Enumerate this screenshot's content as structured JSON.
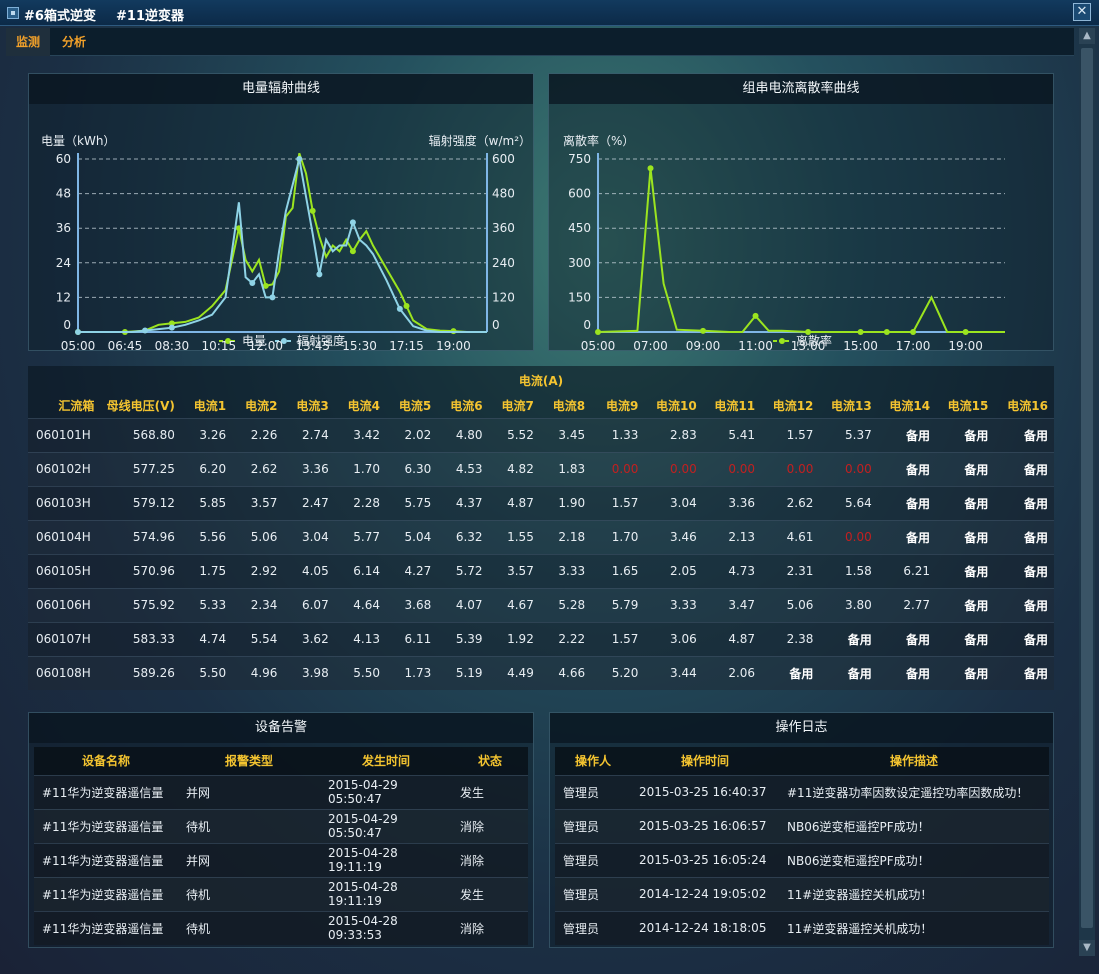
{
  "window": {
    "title_left": "#6箱式逆变",
    "title_right": "#11逆变器",
    "close_glyph": "✕",
    "tabs": [
      {
        "label": "监测"
      },
      {
        "label": "分析"
      }
    ]
  },
  "charts": {
    "energy": {
      "panel_title": "电量辐射曲线",
      "left_unit": "电量（kWh）",
      "right_unit": "辐射强度（w/m²）",
      "legend_energy": "电量",
      "legend_radiation": "辐射强度"
    },
    "dispersion": {
      "panel_title": "组串电流离散率曲线",
      "unit": "离散率（%）",
      "legend": "离散率"
    }
  },
  "chart_data": [
    {
      "type": "line",
      "title": "电量辐射曲线",
      "ylabel": "电量（kWh）",
      "y2label": "辐射强度（w/m²）",
      "ylim": [
        0,
        60
      ],
      "y2lim": [
        0,
        600
      ],
      "yticks": [
        "0",
        "12",
        "24",
        "36",
        "48",
        "60"
      ],
      "y2ticks": [
        "0",
        "120",
        "240",
        "360",
        "480",
        "600"
      ],
      "xlim": [
        5,
        20.25
      ],
      "xticks": [
        "05:00",
        "06:45",
        "08:30",
        "10:15",
        "12:00",
        "13:45",
        "15:30",
        "17:15",
        "19:00"
      ],
      "grid": true,
      "legend": "bottom",
      "series": [
        {
          "name": "电量",
          "color": "#9be41f",
          "x": [
            5.0,
            6.0,
            6.75,
            7.5,
            8.0,
            8.5,
            9.0,
            9.5,
            10.0,
            10.5,
            11.0,
            11.25,
            11.5,
            11.75,
            12.0,
            12.25,
            12.5,
            12.75,
            13.0,
            13.25,
            13.5,
            13.75,
            14.0,
            14.25,
            14.5,
            14.75,
            15.0,
            15.25,
            15.5,
            15.75,
            16.0,
            16.5,
            17.0,
            17.25,
            17.5,
            18.0,
            18.5,
            19.0,
            19.5,
            20.25
          ],
          "y": [
            0,
            0,
            0,
            0.5,
            2.5,
            3.0,
            3.5,
            5.0,
            9.0,
            14.5,
            36.0,
            25.0,
            21.0,
            25.0,
            16.0,
            16.5,
            21.0,
            40.0,
            43.0,
            62.0,
            55.0,
            42.0,
            33.0,
            26.0,
            30.0,
            28.0,
            32.0,
            28.0,
            32.0,
            35.0,
            30.0,
            22.0,
            14.0,
            9.0,
            4.0,
            1.0,
            0.5,
            0.3,
            0,
            0
          ]
        },
        {
          "name": "辐射强度",
          "color": "#8fd3e6",
          "x": [
            5.0,
            6.0,
            7.0,
            7.5,
            8.0,
            8.5,
            9.0,
            9.5,
            10.0,
            10.5,
            11.0,
            11.25,
            11.5,
            11.75,
            12.0,
            12.25,
            12.5,
            12.75,
            13.0,
            13.25,
            13.5,
            13.75,
            14.0,
            14.25,
            14.5,
            14.75,
            15.0,
            15.25,
            15.5,
            15.75,
            16.0,
            16.5,
            17.0,
            17.5,
            18.0,
            18.5,
            19.0,
            20.25
          ],
          "y": [
            0,
            0,
            0,
            5,
            10,
            15,
            25,
            40,
            60,
            120,
            450,
            190,
            170,
            200,
            120,
            120,
            280,
            420,
            510,
            600,
            470,
            340,
            200,
            320,
            280,
            300,
            300,
            380,
            320,
            300,
            270,
            180,
            80,
            20,
            5,
            0,
            0,
            0
          ]
        }
      ]
    },
    {
      "type": "line",
      "title": "组串电流离散率曲线",
      "ylabel": "离散率（%）",
      "ylim": [
        0,
        750
      ],
      "yticks": [
        "0",
        "150",
        "300",
        "450",
        "600",
        "750"
      ],
      "xlim": [
        5,
        20.5
      ],
      "xticks": [
        "05:00",
        "07:00",
        "09:00",
        "11:00",
        "13:00",
        "15:00",
        "17:00",
        "19:00"
      ],
      "grid": true,
      "legend": "bottom",
      "series": [
        {
          "name": "离散率",
          "color": "#9be41f",
          "x": [
            5.0,
            6.5,
            7.0,
            7.5,
            8.0,
            9.0,
            10.0,
            10.5,
            11.0,
            11.5,
            12.0,
            13.0,
            14.0,
            15.0,
            16.0,
            17.0,
            17.7,
            18.3,
            19.0,
            20.5
          ],
          "y": [
            0,
            5,
            710,
            210,
            10,
            5,
            0,
            0,
            70,
            5,
            5,
            0,
            0,
            0,
            0,
            0,
            150,
            0,
            0,
            0
          ]
        }
      ]
    }
  ],
  "monitor": {
    "group_header": "电流(A)",
    "columns": [
      "汇流箱",
      "母线电压(V)",
      "电流1",
      "电流2",
      "电流3",
      "电流4",
      "电流5",
      "电流6",
      "电流7",
      "电流8",
      "电流9",
      "电流10",
      "电流11",
      "电流12",
      "电流13",
      "电流14",
      "电流15",
      "电流16"
    ],
    "rows": [
      [
        "060101H",
        "568.80",
        "3.26",
        "2.26",
        "2.74",
        "3.42",
        "2.02",
        "4.80",
        "5.52",
        "3.45",
        "1.33",
        "2.83",
        "5.41",
        "1.57",
        "5.37",
        "备用",
        "备用",
        "备用"
      ],
      [
        "060102H",
        "577.25",
        "6.20",
        "2.62",
        "3.36",
        "1.70",
        "6.30",
        "4.53",
        "4.82",
        "1.83",
        "0.00",
        "0.00",
        "0.00",
        "0.00",
        "0.00",
        "备用",
        "备用",
        "备用"
      ],
      [
        "060103H",
        "579.12",
        "5.85",
        "3.57",
        "2.47",
        "2.28",
        "5.75",
        "4.37",
        "4.87",
        "1.90",
        "1.57",
        "3.04",
        "3.36",
        "2.62",
        "5.64",
        "备用",
        "备用",
        "备用"
      ],
      [
        "060104H",
        "574.96",
        "5.56",
        "5.06",
        "3.04",
        "5.77",
        "5.04",
        "6.32",
        "1.55",
        "2.18",
        "1.70",
        "3.46",
        "2.13",
        "4.61",
        "0.00",
        "备用",
        "备用",
        "备用"
      ],
      [
        "060105H",
        "570.96",
        "1.75",
        "2.92",
        "4.05",
        "6.14",
        "4.27",
        "5.72",
        "3.57",
        "3.33",
        "1.65",
        "2.05",
        "4.73",
        "2.31",
        "1.58",
        "6.21",
        "备用",
        "备用"
      ],
      [
        "060106H",
        "575.92",
        "5.33",
        "2.34",
        "6.07",
        "4.64",
        "3.68",
        "4.07",
        "4.67",
        "5.28",
        "5.79",
        "3.33",
        "3.47",
        "5.06",
        "3.80",
        "2.77",
        "备用",
        "备用"
      ],
      [
        "060107H",
        "583.33",
        "4.74",
        "5.54",
        "3.62",
        "4.13",
        "6.11",
        "5.39",
        "1.92",
        "2.22",
        "1.57",
        "3.06",
        "4.87",
        "2.38",
        "备用",
        "备用",
        "备用",
        "备用"
      ],
      [
        "060108H",
        "589.26",
        "5.50",
        "4.96",
        "3.98",
        "5.50",
        "1.73",
        "5.19",
        "4.49",
        "4.66",
        "5.20",
        "3.44",
        "2.06",
        "备用",
        "备用",
        "备用",
        "备用",
        "备用"
      ]
    ]
  },
  "alarms": {
    "panel_title": "设备告警",
    "columns": [
      "设备名称",
      "报警类型",
      "发生时间",
      "状态"
    ],
    "rows": [
      [
        "#11华为逆变器遥信量",
        "并网",
        "2015-04-29 05:50:47",
        "发生"
      ],
      [
        "#11华为逆变器遥信量",
        "待机",
        "2015-04-29 05:50:47",
        "消除"
      ],
      [
        "#11华为逆变器遥信量",
        "并网",
        "2015-04-28 19:11:19",
        "消除"
      ],
      [
        "#11华为逆变器遥信量",
        "待机",
        "2015-04-28 19:11:19",
        "发生"
      ],
      [
        "#11华为逆变器遥信量",
        "待机",
        "2015-04-28 09:33:53",
        "消除"
      ]
    ]
  },
  "logs": {
    "panel_title": "操作日志",
    "columns": [
      "操作人",
      "操作时间",
      "操作描述"
    ],
    "rows": [
      [
        "管理员",
        "2015-03-25 16:40:37",
        "#11逆变器功率因数设定遥控功率因数成功！"
      ],
      [
        "管理员",
        "2015-03-25 16:06:57",
        "NB06逆变柜遥控PF成功！"
      ],
      [
        "管理员",
        "2015-03-25 16:05:24",
        "NB06逆变柜遥控PF成功！"
      ],
      [
        "管理员",
        "2014-12-24 19:05:02",
        "11#逆变器遥控关机成功！"
      ],
      [
        "管理员",
        "2014-12-24 18:18:05",
        "11#逆变器遥控关机成功！"
      ]
    ]
  },
  "colors": {
    "accent_orange": "#f2a12a",
    "header_yellow": "#f4c430",
    "energy_line": "#9be41f",
    "radiation_line": "#8fd3e6",
    "alert_red": "#c22020"
  },
  "icons": [
    "window-icon",
    "close-icon",
    "scroll-up-icon",
    "scroll-down-icon"
  ]
}
